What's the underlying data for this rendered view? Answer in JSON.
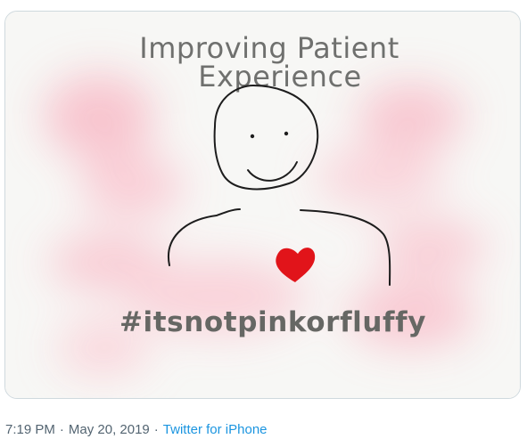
{
  "tweet": {
    "image": {
      "title_line1": "Improving Patient",
      "title_line2": "Experience",
      "hashtag": "#itsnotpinkorfluffy",
      "heart_color": "#e1141a",
      "blush_color": "#f7b7c4"
    },
    "meta": {
      "time": "7:19 PM",
      "separator": "·",
      "date": "May 20, 2019",
      "source": "Twitter for iPhone"
    }
  }
}
